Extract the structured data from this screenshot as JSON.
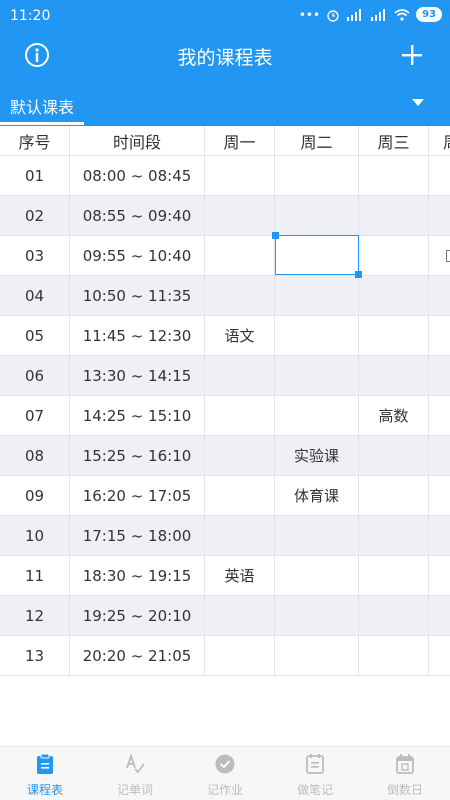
{
  "status": {
    "time": "11:20",
    "battery": "93"
  },
  "header": {
    "title": "我的课程表"
  },
  "selector": {
    "label": "默认课表"
  },
  "table": {
    "headers": [
      "序号",
      "时间段",
      "周一",
      "周二",
      "周三",
      "周"
    ],
    "rows": [
      {
        "no": "01",
        "time": "08:00 ~ 08:45",
        "mon": "",
        "tue": "",
        "wed": ""
      },
      {
        "no": "02",
        "time": "08:55 ~ 09:40",
        "mon": "",
        "tue": "",
        "wed": ""
      },
      {
        "no": "03",
        "time": "09:55 ~ 10:40",
        "mon": "",
        "tue": "",
        "wed": ""
      },
      {
        "no": "04",
        "time": "10:50 ~ 11:35",
        "mon": "",
        "tue": "",
        "wed": ""
      },
      {
        "no": "05",
        "time": "11:45 ~ 12:30",
        "mon": "语文",
        "tue": "",
        "wed": ""
      },
      {
        "no": "06",
        "time": "13:30 ~ 14:15",
        "mon": "",
        "tue": "",
        "wed": ""
      },
      {
        "no": "07",
        "time": "14:25 ~ 15:10",
        "mon": "",
        "tue": "",
        "wed": "高数"
      },
      {
        "no": "08",
        "time": "15:25 ~ 16:10",
        "mon": "",
        "tue": "实验课",
        "wed": ""
      },
      {
        "no": "09",
        "time": "16:20 ~ 17:05",
        "mon": "",
        "tue": "体育课",
        "wed": ""
      },
      {
        "no": "10",
        "time": "17:15 ~ 18:00",
        "mon": "",
        "tue": "",
        "wed": ""
      },
      {
        "no": "11",
        "time": "18:30 ~ 19:15",
        "mon": "英语",
        "tue": "",
        "wed": ""
      },
      {
        "no": "12",
        "time": "19:25 ~ 20:10",
        "mon": "",
        "tue": "",
        "wed": ""
      },
      {
        "no": "13",
        "time": "20:20 ~ 21:05",
        "mon": "",
        "tue": "",
        "wed": ""
      }
    ]
  },
  "tabs": [
    {
      "label": "课程表",
      "icon": "clipboard-icon",
      "active": true
    },
    {
      "label": "记单词",
      "icon": "spell-check-icon",
      "active": false
    },
    {
      "label": "记作业",
      "icon": "check-circle-icon",
      "active": false
    },
    {
      "label": "做笔记",
      "icon": "notepad-icon",
      "active": false
    },
    {
      "label": "倒数日",
      "icon": "calendar-icon",
      "active": false
    }
  ],
  "colors": {
    "primary": "#2196f3",
    "alt_row": "#eef0f5",
    "inactive": "#bcbcbc"
  }
}
